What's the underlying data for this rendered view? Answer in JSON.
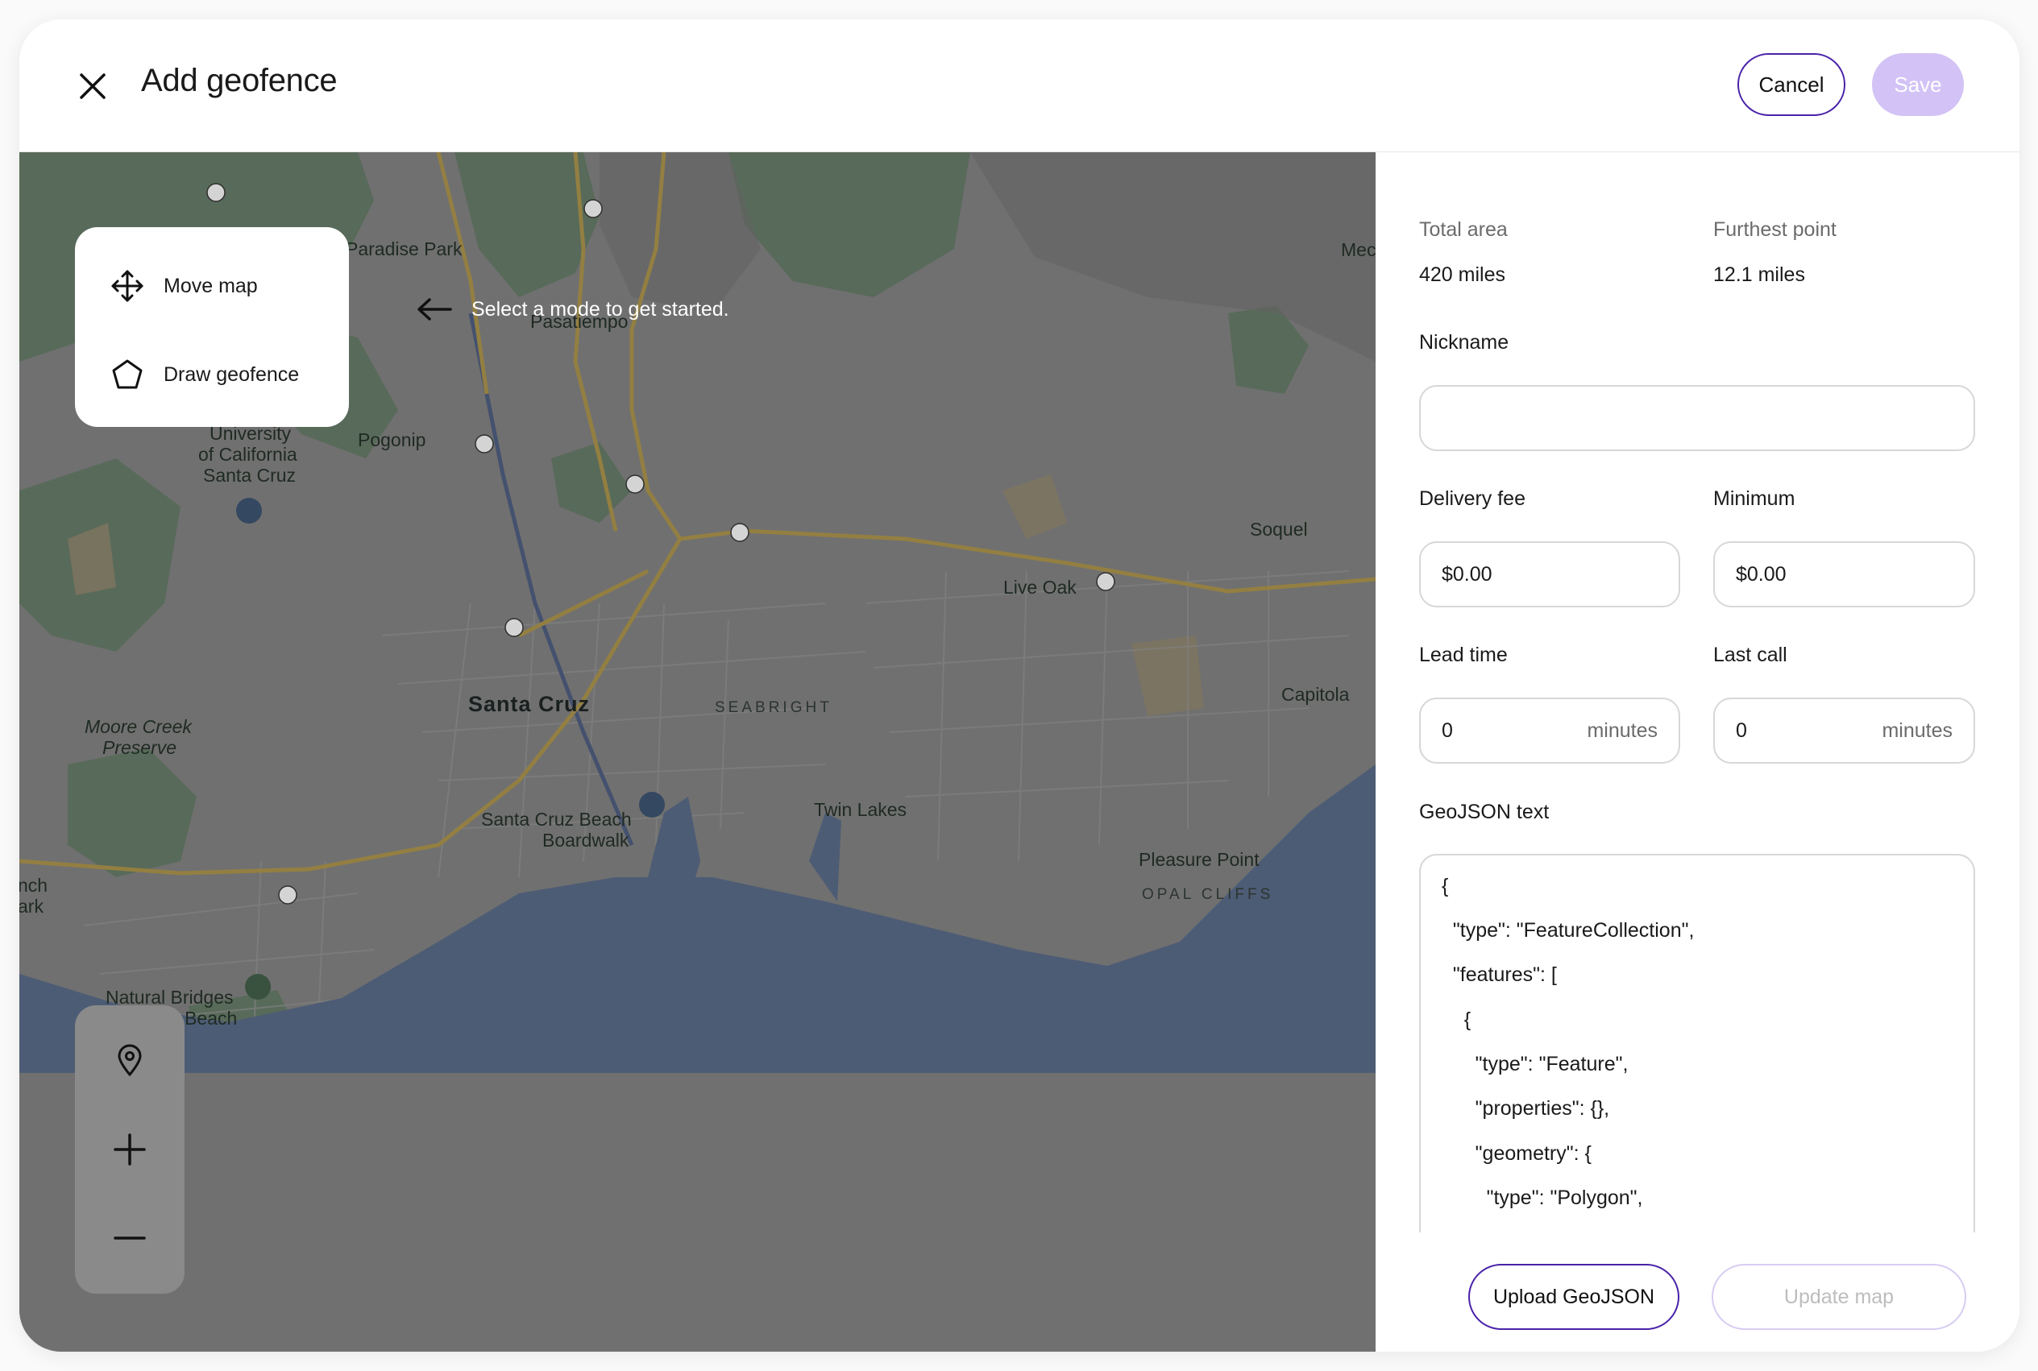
{
  "header": {
    "title": "Add geofence",
    "cancel_label": "Cancel",
    "save_label": "Save"
  },
  "map": {
    "modes": [
      {
        "label": "Move map",
        "icon": "move-icon"
      },
      {
        "label": "Draw geofence",
        "icon": "pentagon-icon"
      }
    ],
    "hint": "Select a mode to get started.",
    "place_labels": {
      "paradise_park": "Paradise Park",
      "pasatiempo": "Pasatiempo",
      "ucsc_1": "University",
      "ucsc_2": "of California",
      "ucsc_3": "Santa Cruz",
      "pogonip": "Pogonip",
      "soquel": "Soquel",
      "live_oak": "Live Oak",
      "santa_cruz": "Santa Cruz",
      "seabright": "SEABRIGHT",
      "capitola": "Capitola",
      "moore_1": "Moore Creek",
      "moore_2": "Preserve",
      "boardwalk_1": "Santa Cruz Beach",
      "boardwalk_2": "Boardwalk",
      "twin_lakes": "Twin Lakes",
      "pleasure_point": "Pleasure Point",
      "opal_cliffs": "OPAL CLIFFS",
      "natural_1": "Natural Bridges",
      "natural_2": "State Beach",
      "mec": "Mec",
      "nch": "nch",
      "ark": "ark"
    },
    "controls": [
      "location-pin-icon",
      "zoom-in-icon",
      "zoom-out-icon"
    ]
  },
  "panel": {
    "total_area_label": "Total area",
    "total_area_value": "420 miles",
    "furthest_label": "Furthest point",
    "furthest_value": "12.1 miles",
    "nickname_label": "Nickname",
    "nickname_value": "",
    "delivery_fee_label": "Delivery fee",
    "delivery_fee_value": "$0.00",
    "minimum_label": "Minimum",
    "minimum_value": "$0.00",
    "lead_time_label": "Lead time",
    "lead_time_value": "0",
    "lead_time_unit": "minutes",
    "last_call_label": "Last call",
    "last_call_value": "0",
    "last_call_unit": "minutes",
    "geojson_label": "GeoJSON text",
    "geojson_lines": [
      "{",
      "  \"type\": \"FeatureCollection\",",
      "  \"features\": [",
      "    {",
      "      \"type\": \"Feature\",",
      "      \"properties\": {},",
      "      \"geometry\": {",
      "        \"type\": \"Polygon\","
    ],
    "upload_label": "Upload GeoJSON",
    "update_label": "Update map"
  },
  "colors": {
    "accent": "#4a22a8",
    "save_disabled": "#d2c2f5",
    "water": "#54647f",
    "land": "#7a7a7a",
    "road": "#a08a48"
  }
}
